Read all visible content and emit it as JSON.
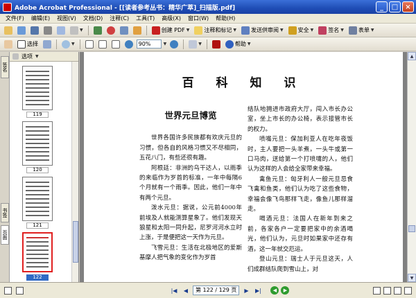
{
  "window": {
    "title": "Adobe Acrobat Professional - [[读者参考丛书：精华广萃]_扫描版.pdf]",
    "minimize": "_",
    "maximize": "□",
    "close": "×"
  },
  "menu": [
    "文件(F)",
    "编辑(E)",
    "视图(V)",
    "文档(D)",
    "注释(C)",
    "工具(T)",
    "高级(X)",
    "窗口(W)",
    "帮助(H)"
  ],
  "toolbar1": {
    "cut": "",
    "print_label": "",
    "snapshot": "",
    "create_pdf": "创建 PDF",
    "review_comment": "注释和标记",
    "send_review": "发送供审阅",
    "secure": "安全",
    "sign": "签名",
    "forms": "表单"
  },
  "toolbar2": {
    "select_label": "选择",
    "zoom_value": "90%",
    "help_label": "帮助"
  },
  "nav_tabs": [
    "签名",
    "书签",
    "页面"
  ],
  "thumb_panel": {
    "options_label": "选项",
    "pages": [
      {
        "label": "119",
        "selected": false
      },
      {
        "label": "120",
        "selected": false
      },
      {
        "label": "121",
        "selected": false
      },
      {
        "label": "122",
        "selected": true
      }
    ]
  },
  "document": {
    "page_title": "百 科 知 识",
    "section_heading": "世界元旦博览",
    "left_paragraphs": [
      "世界各国许多民族都有欢庆元旦的习惯，但各自的风格习惯又不尽相同，五花八门，有些还很有趣。",
      "阿根廷：非洲的乌干达人，以雨季的来临作为岁首的标准，一年中每隔6个月就有一个雨季。因此，他们一年中有两个元旦。",
      "泼水元旦：据说，公元前4000年前埃及人就能测算星象了。他们发现天狼星和太阳一同升起，尼罗河河水立时上涨，于是便把这一天作为元旦。",
      "飞雪元旦：生活在北极地区的爱斯基摩人把气象的变化作为岁首"
    ],
    "right_paragraphs": [
      "结队地拥进市政府大厅，闯入市长办公室，坐上市长的办公椅，表示接管市长的权力。",
      "喷嘴元旦：保加利亚人在吃年夜饭时，主人要把一头羊煮，一头牛或第一口马肉，送给第一个打喷嚏的人，他们认为这样的人会给全家带来幸福。",
      "禽鱼元旦：匈牙利人一般元旦忌食飞禽和鱼类，他们认为吃了这些食物，幸福会像飞鸟那样飞走，像鱼儿那样溜走。",
      "喝酒元旦：法国人在新年到来之前，各家各户一定要把家中的余酒喝光，他们认为，元旦时如果家中还存有酒，这一年就交厄运。",
      "登山元旦：瑞士人于元旦这天，人们成群结队爬到雪山上，对"
    ]
  },
  "status": {
    "page_indicator": "第 122 / 129 页"
  }
}
